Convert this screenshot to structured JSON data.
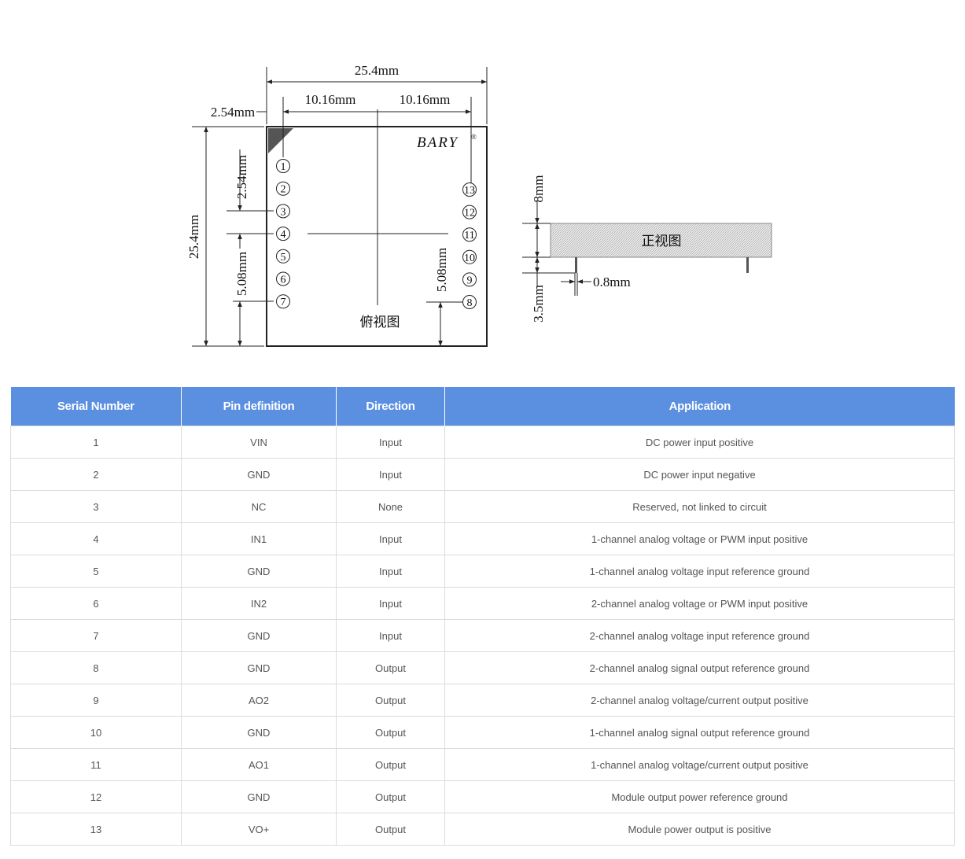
{
  "diagram": {
    "top_view": {
      "brand": "BARY",
      "registered_mark": "®",
      "view_label": "俯视图",
      "dims": {
        "width": "25.4mm",
        "half_left": "10.16mm",
        "half_right": "10.16mm",
        "offset": "2.54mm",
        "height": "25.4mm",
        "pitch": "2.54mm",
        "left_gap": "5.08mm",
        "right_gap": "5.08mm"
      },
      "pins_left": [
        "1",
        "2",
        "3",
        "4",
        "5",
        "6",
        "7"
      ],
      "pins_right": [
        "13",
        "12",
        "11",
        "10",
        "9",
        "8"
      ]
    },
    "front_view": {
      "view_label": "正视图",
      "dims": {
        "height": "8mm",
        "pin_length": "3.5mm",
        "pin_width": "0.8mm"
      }
    }
  },
  "table": {
    "headers": [
      "Serial Number",
      "Pin definition",
      "Direction",
      "Application"
    ],
    "rows": [
      [
        "1",
        "VIN",
        "Input",
        "DC power input positive"
      ],
      [
        "2",
        "GND",
        "Input",
        "DC power input negative"
      ],
      [
        "3",
        "NC",
        "None",
        "Reserved, not linked to circuit"
      ],
      [
        "4",
        "IN1",
        "Input",
        "1-channel analog voltage or PWM input positive"
      ],
      [
        "5",
        "GND",
        "Input",
        "1-channel analog voltage input reference ground"
      ],
      [
        "6",
        "IN2",
        "Input",
        "2-channel analog voltage or PWM input positive"
      ],
      [
        "7",
        "GND",
        "Input",
        "2-channel analog voltage input reference ground"
      ],
      [
        "8",
        "GND",
        "Output",
        "2-channel analog signal output reference ground"
      ],
      [
        "9",
        "AO2",
        "Output",
        "2-channel analog voltage/current output positive"
      ],
      [
        "10",
        "GND",
        "Output",
        "1-channel analog signal output reference ground"
      ],
      [
        "11",
        "AO1",
        "Output",
        "1-channel analog voltage/current output positive"
      ],
      [
        "12",
        "GND",
        "Output",
        "Module output power reference ground"
      ],
      [
        "13",
        "VO+",
        "Output",
        "Module power output is positive"
      ]
    ]
  },
  "colors": {
    "header_bg": "#5b8fe0",
    "header_text": "#ffffff",
    "border": "#dcdcdc"
  }
}
